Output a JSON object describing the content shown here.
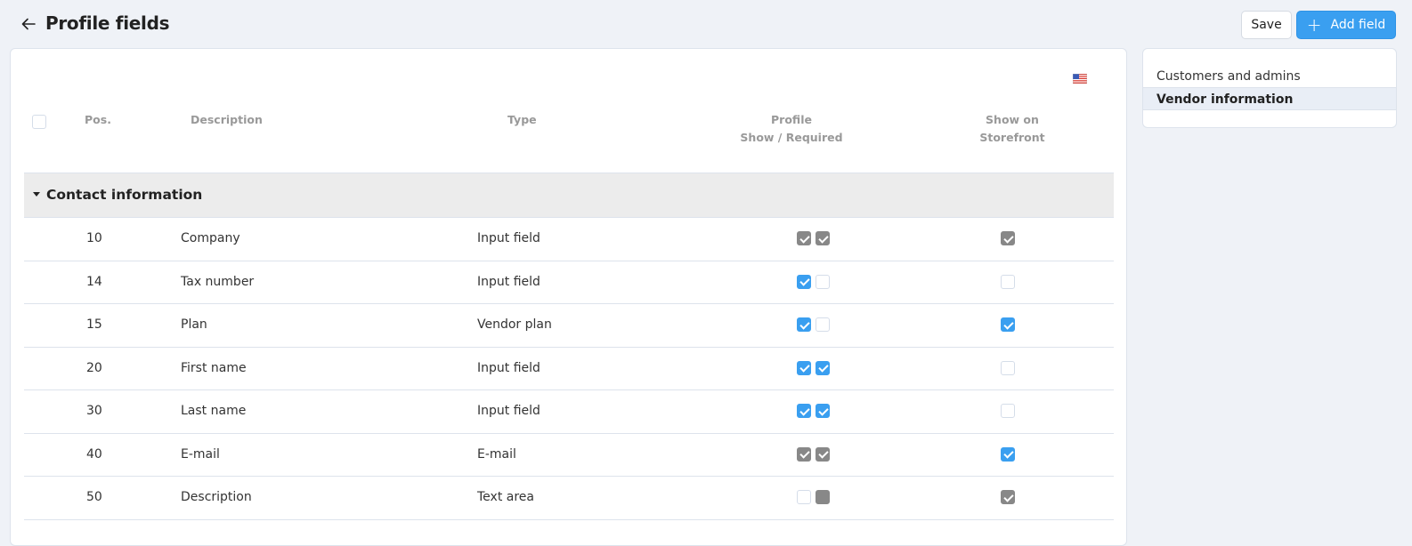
{
  "header": {
    "title": "Profile fields",
    "save_label": "Save",
    "add_label": "Add field"
  },
  "language": {
    "icon": "us-flag-icon",
    "code": "en"
  },
  "table": {
    "columns": {
      "pos": "Pos.",
      "description": "Description",
      "type": "Type",
      "profile_line1": "Profile",
      "profile_line2": "Show / Required",
      "storefront_line1": "Show on",
      "storefront_line2": "Storefront"
    },
    "group": {
      "label": "Contact information",
      "expanded": true
    },
    "rows": [
      {
        "pos": "10",
        "description": "Company",
        "type": "Input field",
        "show": "checked-gray",
        "required": "checked-gray",
        "storefront": "checked-gray"
      },
      {
        "pos": "14",
        "description": "Tax number",
        "type": "Input field",
        "show": "checked-blue",
        "required": "unchecked",
        "storefront": "unchecked"
      },
      {
        "pos": "15",
        "description": "Plan",
        "type": "Vendor plan",
        "show": "checked-blue",
        "required": "unchecked",
        "storefront": "checked-blue"
      },
      {
        "pos": "20",
        "description": "First name",
        "type": "Input field",
        "show": "checked-blue",
        "required": "checked-blue",
        "storefront": "unchecked"
      },
      {
        "pos": "30",
        "description": "Last name",
        "type": "Input field",
        "show": "checked-blue",
        "required": "checked-blue",
        "storefront": "unchecked"
      },
      {
        "pos": "40",
        "description": "E-mail",
        "type": "E-mail",
        "show": "checked-gray",
        "required": "checked-gray",
        "storefront": "checked-blue"
      },
      {
        "pos": "50",
        "description": "Description",
        "type": "Text area",
        "show": "unchecked",
        "required": "filled-gray",
        "storefront": "checked-gray"
      }
    ]
  },
  "sidebar": {
    "items": [
      {
        "label": "Customers and admins",
        "active": false
      },
      {
        "label": "Vendor information",
        "active": true
      }
    ]
  },
  "colors": {
    "accent": "#3a9ff0",
    "disabled_check": "#888888",
    "page_bg": "#eff2f7",
    "group_bg": "#ececec"
  }
}
